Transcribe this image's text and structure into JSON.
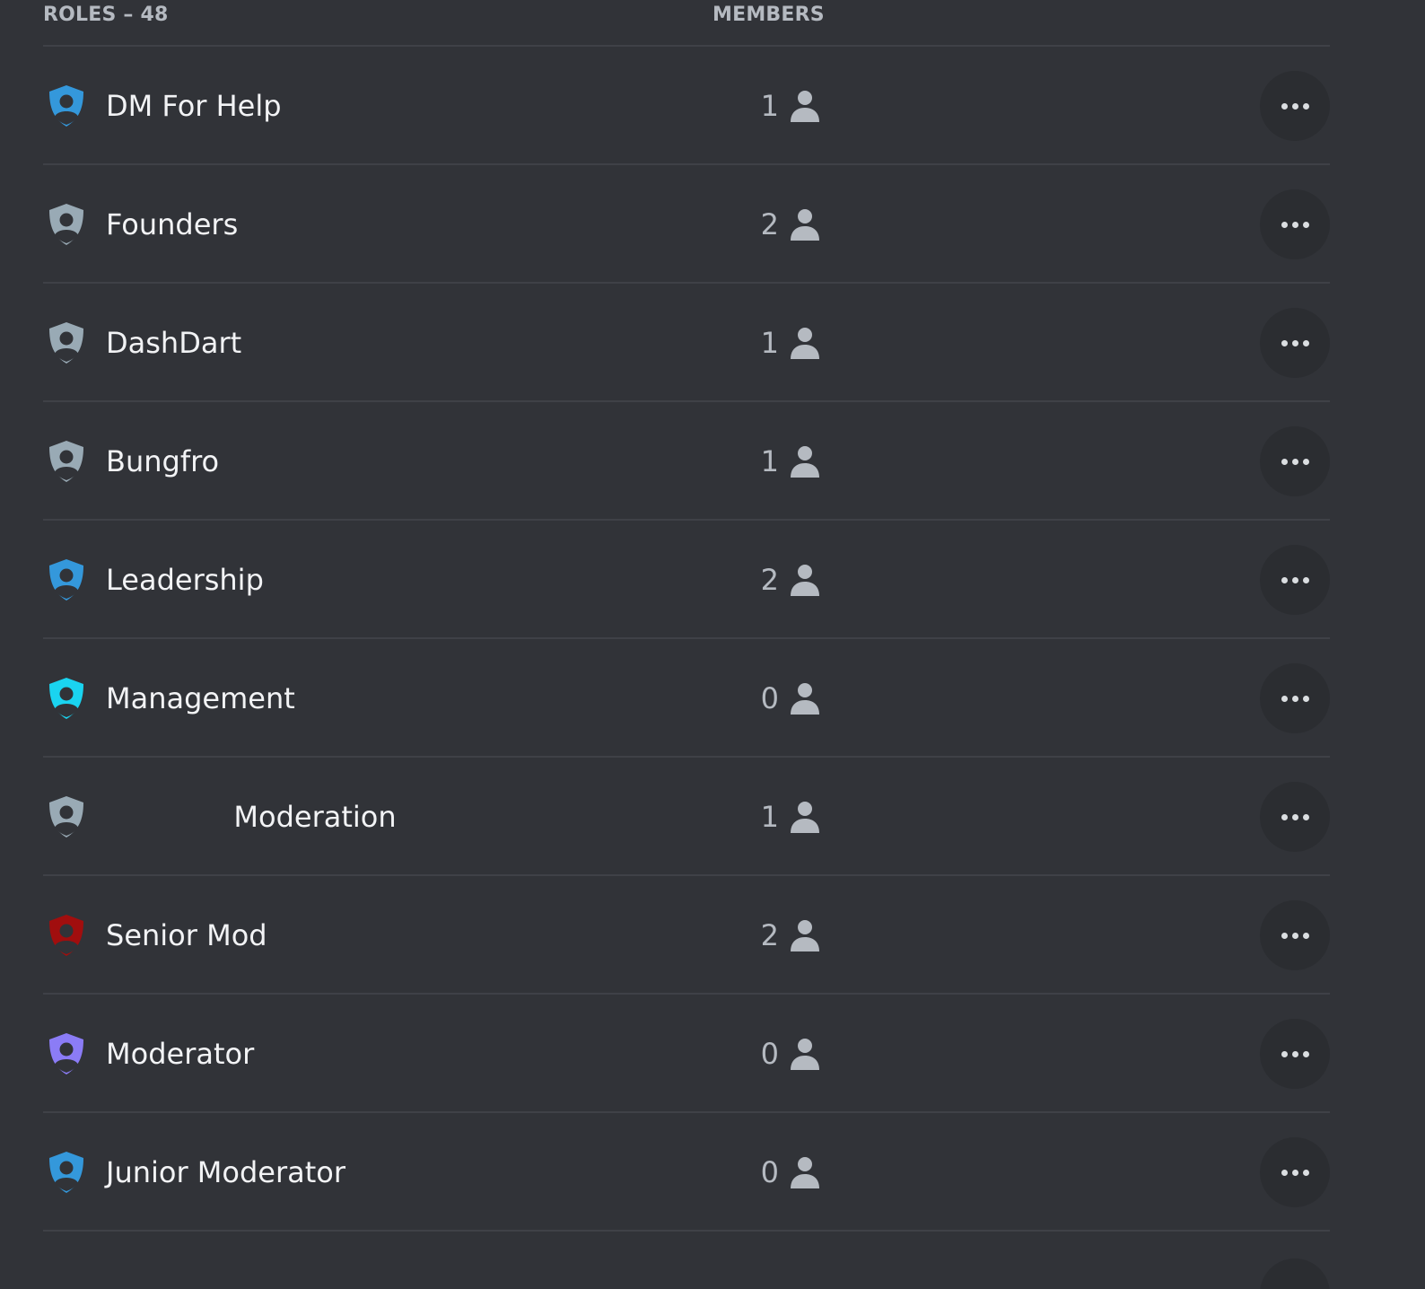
{
  "header": {
    "roles_label": "ROLES – 48",
    "members_label": "MEMBERS"
  },
  "roles": [
    {
      "name": "DM For Help",
      "members": "1",
      "color": "#3498db"
    },
    {
      "name": "Founders",
      "members": "2",
      "color": "#99aab5"
    },
    {
      "name": "DashDart",
      "members": "1",
      "color": "#99aab5"
    },
    {
      "name": "Bungfro",
      "members": "1",
      "color": "#99aab5"
    },
    {
      "name": "Leadership",
      "members": "2",
      "color": "#3498db"
    },
    {
      "name": "Management",
      "members": "0",
      "color": "#1ad4f0"
    },
    {
      "name": "              Moderation",
      "members": "1",
      "color": "#99aab5"
    },
    {
      "name": "Senior Mod",
      "members": "2",
      "color": "#a10e0e"
    },
    {
      "name": "Moderator",
      "members": "0",
      "color": "#8b7cf6"
    },
    {
      "name": "Junior Moderator",
      "members": "0",
      "color": "#3498db"
    }
  ],
  "icons": {
    "role": "shield-user-icon",
    "members": "person-icon",
    "more": "more-dots-icon"
  }
}
